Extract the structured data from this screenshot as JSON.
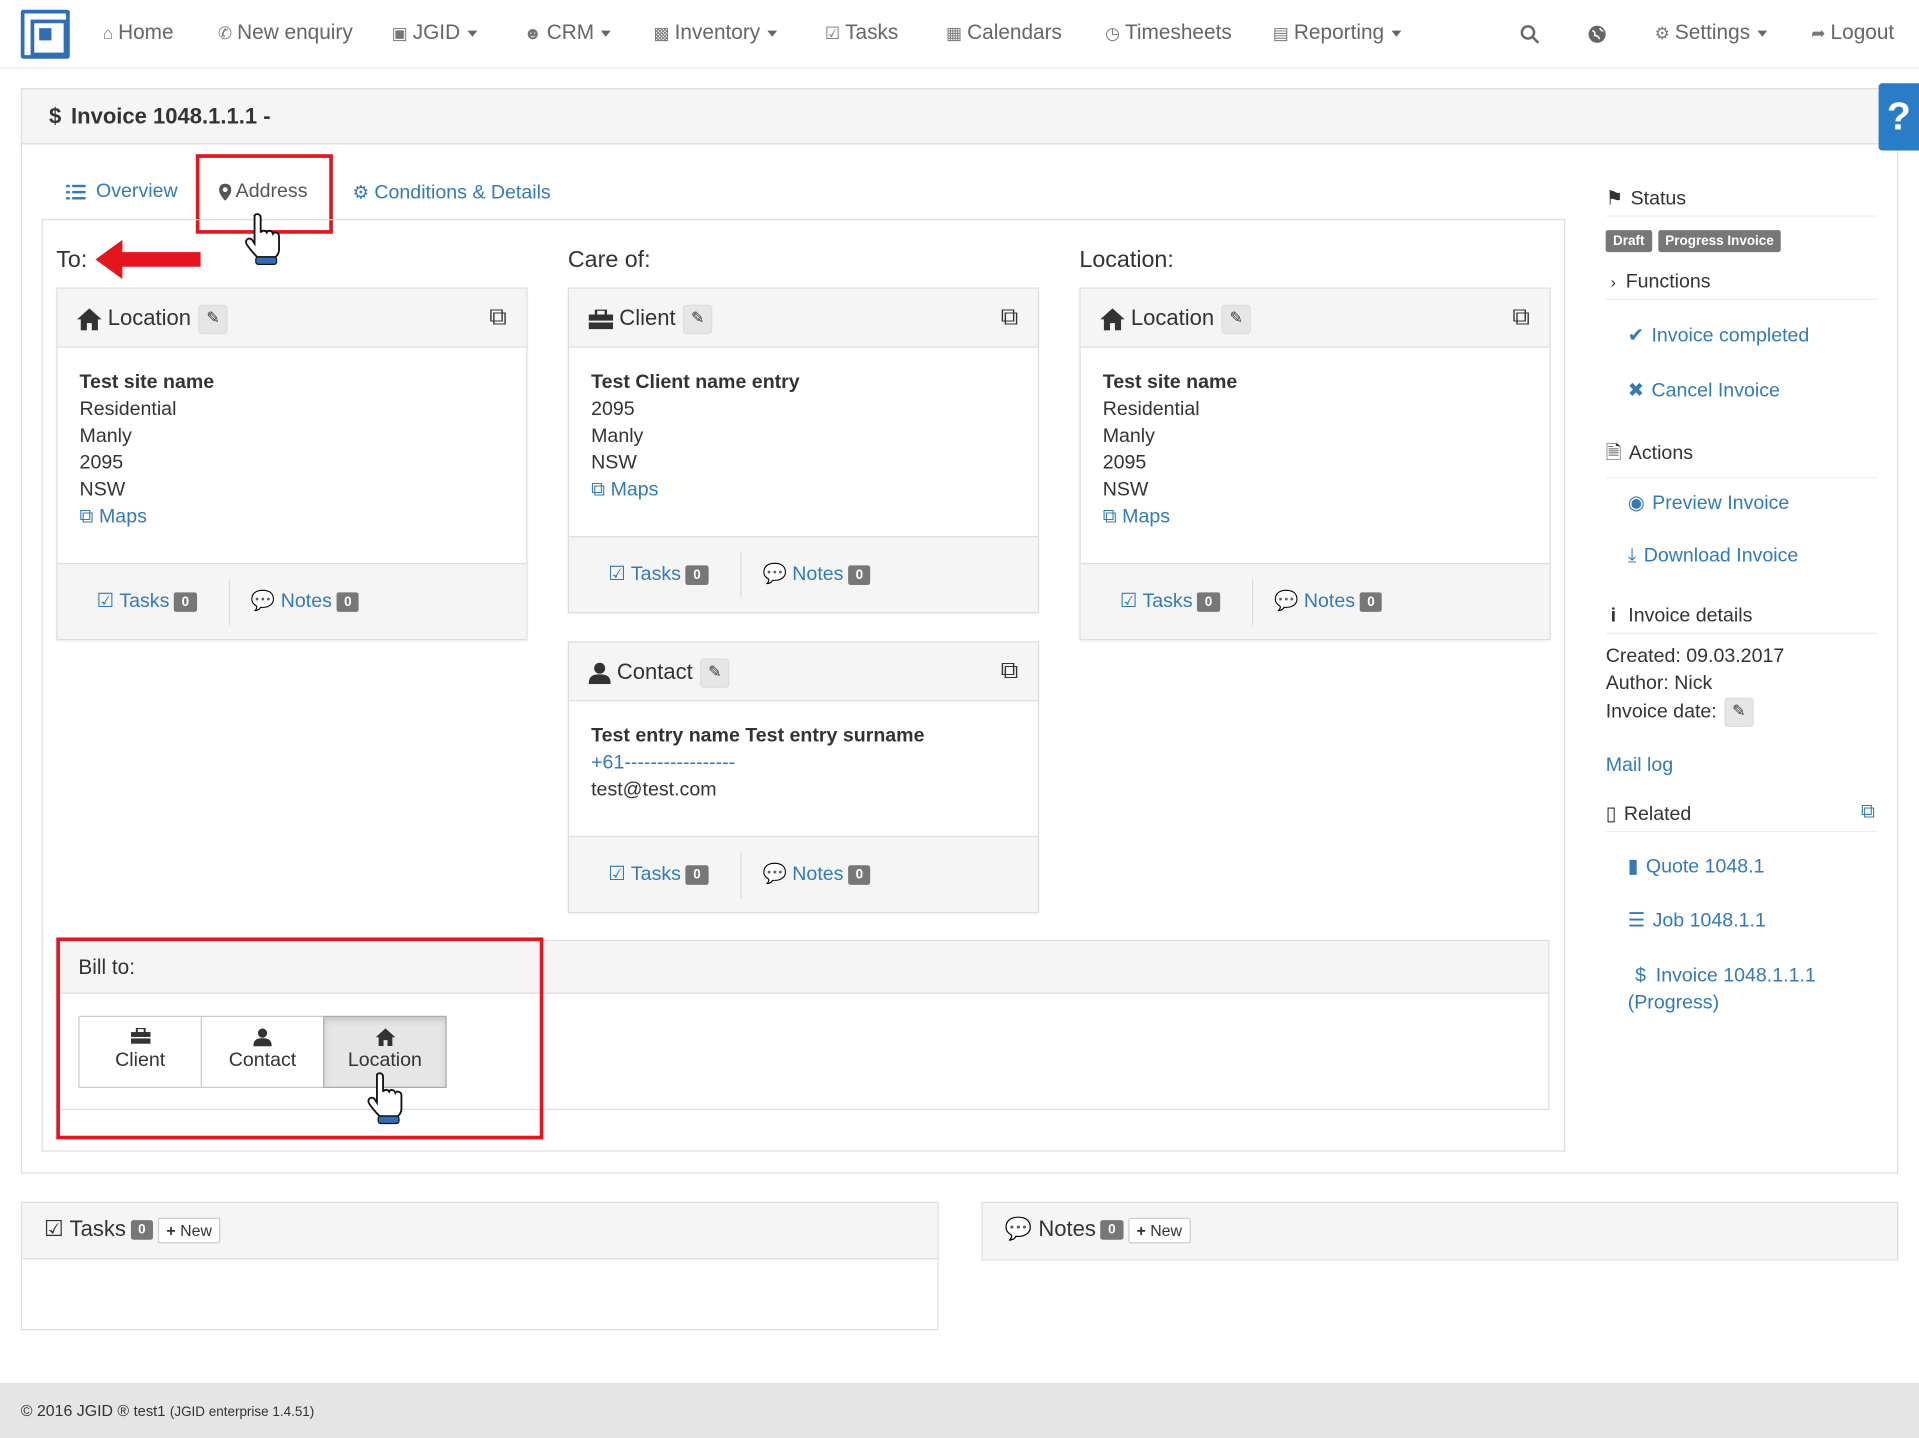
{
  "nav": {
    "home": "Home",
    "new_enquiry": "New enquiry",
    "jgid": "JGID",
    "crm": "CRM",
    "inventory": "Inventory",
    "tasks": "Tasks",
    "calendars": "Calendars",
    "timesheets": "Timesheets",
    "reporting": "Reporting",
    "settings": "Settings",
    "logout": "Logout"
  },
  "page": {
    "title": "Invoice 1048.1.1.1 -",
    "help": "?"
  },
  "tabs": {
    "overview": "Overview",
    "address": "Address",
    "conditions": "Conditions & Details"
  },
  "to": {
    "label": "To:",
    "card_title": "Location",
    "name": "Test site name",
    "lines": [
      "Residential",
      "Manly",
      "2095",
      "NSW"
    ],
    "maps": "Maps",
    "tasks": "Tasks",
    "tasks_count": "0",
    "notes": "Notes",
    "notes_count": "0"
  },
  "care_of": {
    "label": "Care of:",
    "client": {
      "card_title": "Client",
      "name": "Test Client name entry",
      "lines": [
        "2095",
        "Manly",
        "NSW"
      ],
      "maps": "Maps",
      "tasks": "Tasks",
      "tasks_count": "0",
      "notes": "Notes",
      "notes_count": "0"
    },
    "contact": {
      "card_title": "Contact",
      "name": "Test entry name Test entry surname",
      "phone": "+61-----------------",
      "email": "test@test.com",
      "tasks": "Tasks",
      "tasks_count": "0",
      "notes": "Notes",
      "notes_count": "0"
    }
  },
  "location": {
    "label": "Location:",
    "card_title": "Location",
    "name": "Test site name",
    "lines": [
      "Residential",
      "Manly",
      "2095",
      "NSW"
    ],
    "maps": "Maps",
    "tasks": "Tasks",
    "tasks_count": "0",
    "notes": "Notes",
    "notes_count": "0"
  },
  "bill_to": {
    "label": "Bill to:",
    "options": [
      "Client",
      "Contact",
      "Location"
    ],
    "selected": "Location"
  },
  "sidebar": {
    "status_heading": "Status",
    "status_labels": [
      "Draft",
      "Progress Invoice"
    ],
    "functions_heading": "Functions",
    "invoice_completed": "Invoice completed",
    "cancel_invoice": "Cancel Invoice",
    "actions_heading": "Actions",
    "preview_invoice": "Preview Invoice",
    "download_invoice": "Download Invoice",
    "details_heading": "Invoice details",
    "created": "Created: 09.03.2017",
    "author": "Author: Nick",
    "invoice_date": "Invoice date:",
    "mail_log": "Mail log",
    "related_heading": "Related",
    "related_quote": "Quote 1048.1",
    "related_job": "Job 1048.1.1",
    "related_invoice_1": "Invoice 1048.1.1.1",
    "related_invoice_2": "(Progress)"
  },
  "bottom": {
    "tasks_title": "Tasks",
    "tasks_count": "0",
    "notes_title": "Notes",
    "notes_count": "0",
    "new_label": "New"
  },
  "footer": {
    "copyright": "© 2016 JGID ®",
    "user": "test1",
    "version": "(JGID enterprise 1.4.51)"
  },
  "colors": {
    "link": "#337ab7",
    "highlight": "#e3161f",
    "help": "#2a7cc7"
  }
}
